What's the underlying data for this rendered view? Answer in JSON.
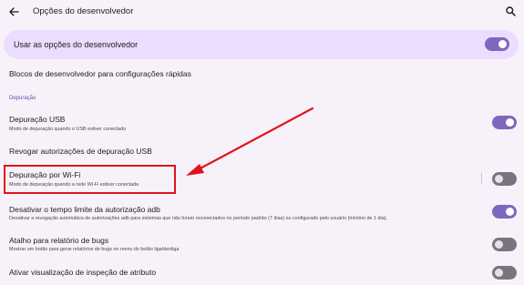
{
  "header": {
    "title": "Opções do desenvolvedor",
    "back_icon": "arrow-back-icon",
    "search_icon": "search-icon"
  },
  "master_toggle": {
    "label": "Usar as opções do desenvolvedor",
    "on": true
  },
  "quick_tiles": {
    "title": "Blocos de desenvolvedor para configurações rápidas"
  },
  "section": {
    "label": "Depuração"
  },
  "settings": {
    "usb_debugging": {
      "title": "Depuração USB",
      "subtitle": "Modo de depuração quando o USB estiver conectado",
      "on": true
    },
    "revoke_usb": {
      "title": "Revogar autorizações de depuração USB"
    },
    "wifi_debugging": {
      "title": "Depuração por Wi-Fi",
      "subtitle": "Modo de depuração quando a rede Wi-Fi estiver conectada",
      "on": false
    },
    "adb_timeout": {
      "title": "Desativar o tempo limite da autorização adb",
      "subtitle": "Desativar a revogação automática de autorizações adb para sistemas que não foram reconectados no período padrão (7 dias) ou configurado pelo usuário (mínimo de 1 dia).",
      "on": true
    },
    "bug_report": {
      "title": "Atalho para relatório de bugs",
      "subtitle": "Mostrar um botão para gerar relatórios de bugs no menu do botão liga/desliga",
      "on": false
    },
    "attribute_inspection": {
      "title": "Ativar visualização de inspeção de atributo",
      "on": false
    }
  },
  "colors": {
    "accent": "#7f67be",
    "highlight": "#e0131a",
    "master_bg": "#eaddff",
    "background": "#f7f2fa"
  }
}
